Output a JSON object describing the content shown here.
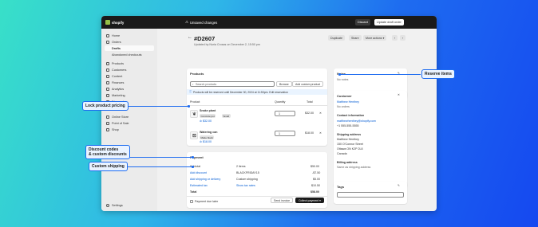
{
  "topbar": {
    "brand": "shopify",
    "status": "Unsaved changes",
    "discard": "Discard",
    "update": "Update draft order"
  },
  "sidebar": {
    "items": [
      {
        "label": "Home"
      },
      {
        "label": "Orders"
      },
      {
        "label": "Drafts"
      },
      {
        "label": "Abandoned checkouts"
      },
      {
        "label": "Products"
      },
      {
        "label": "Customers"
      },
      {
        "label": "Content"
      },
      {
        "label": "Finances"
      },
      {
        "label": "Analytics"
      },
      {
        "label": "Marketing"
      },
      {
        "label": "Discounts"
      },
      {
        "label": "Online Store"
      },
      {
        "label": "Point of Sale"
      },
      {
        "label": "Shop"
      },
      {
        "label": "Settings"
      }
    ]
  },
  "header": {
    "title": "#D2607",
    "subtitle": "Updated by Nuria Crosas on December 2, 15:50 pm",
    "duplicate": "Duplicate",
    "share": "Share",
    "more": "More actions"
  },
  "products": {
    "title": "Products",
    "search_placeholder": "Search products",
    "browse": "Browse",
    "add_custom": "Add custom product",
    "notice": "Products will be reserved until December 30, 2024 at 11:50pm. Edit reservation",
    "col_product": "Product",
    "col_quantity": "Quantity",
    "col_total": "Total",
    "items": [
      {
        "name": "Snake plant",
        "variant1": "Concrete pot",
        "variant2": "Small",
        "price": "$32.00",
        "qty": "1",
        "total": "$32.00"
      },
      {
        "name": "Watering can",
        "variant1": "Matte black",
        "price": "$18.00",
        "qty": "1",
        "total": "$18.00"
      }
    ]
  },
  "payment": {
    "title": "Payment",
    "rows": [
      {
        "label": "Subtotal",
        "mid": "2 items",
        "amount": "$50.00"
      },
      {
        "label": "Add discount",
        "mid": "BLACKFRIDAY15",
        "amount": "-$7.50"
      },
      {
        "label": "Add shipping or delivery",
        "mid": "Custom shipping",
        "amount": "$5.00"
      },
      {
        "label": "Estimated tax",
        "mid": "Show tax rates",
        "amount": "$10.50"
      },
      {
        "label": "Total",
        "mid": "",
        "amount": "$58.00"
      }
    ],
    "due_later": "Payment due later",
    "send_invoice": "Send invoice",
    "collect": "Collect payment"
  },
  "notes": {
    "title": "Notes",
    "value": "No notes"
  },
  "customer": {
    "title": "Customer",
    "name": "Matthew Henthey",
    "orders": "No orders",
    "contact_title": "Contact information",
    "email": "matthewhenthey@shopify.com",
    "phone": "+1 555-555-5555",
    "shipping_title": "Shipping address",
    "address": [
      "Matthew Henthey",
      "150 O'Connor Street",
      "Ottawa ON K2P 2L8",
      "Canada"
    ],
    "billing_title": "Billing address",
    "billing": "Same as shipping address"
  },
  "tags": {
    "title": "Tags"
  },
  "annotations": {
    "reserve": "Reserve items",
    "lock": "Lock product pricing",
    "discount": "Discount codes\n& custom discounts",
    "discount_l1": "Discount codes",
    "discount_l2": "& custom discounts",
    "shipping": "Custom shipping"
  },
  "colors": {
    "accent": "#1e6cf0",
    "brand": "#95bf47",
    "link": "#005bd3"
  }
}
